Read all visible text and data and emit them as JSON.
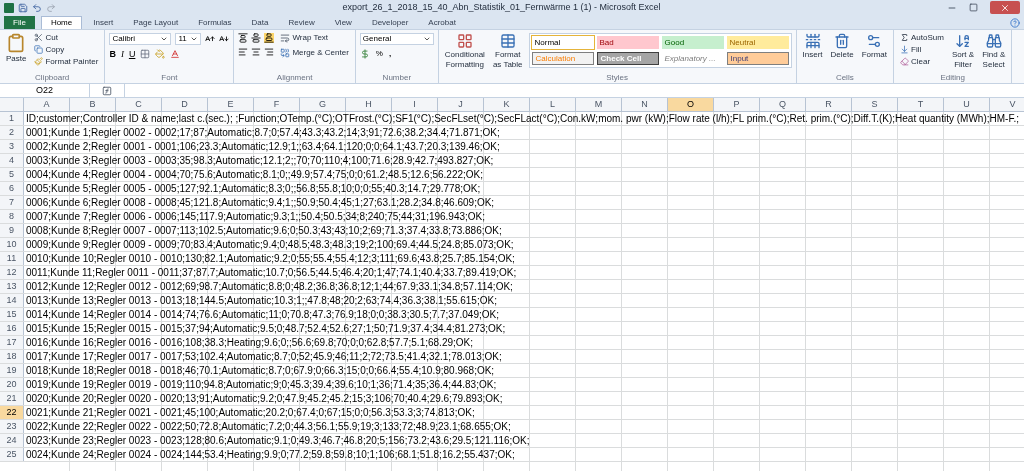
{
  "window": {
    "title": "export_26_1_2018_15_40_Abn_Statistik_01_Fernwärme 1 (1)  -  Microsoft Excel"
  },
  "tabs": [
    {
      "label": "File",
      "kind": "file",
      "selected": false
    },
    {
      "label": "Home",
      "kind": "tab",
      "selected": true
    },
    {
      "label": "Insert",
      "kind": "tab",
      "selected": false
    },
    {
      "label": "Page Layout",
      "kind": "tab",
      "selected": false
    },
    {
      "label": "Formulas",
      "kind": "tab",
      "selected": false
    },
    {
      "label": "Data",
      "kind": "tab",
      "selected": false
    },
    {
      "label": "Review",
      "kind": "tab",
      "selected": false
    },
    {
      "label": "View",
      "kind": "tab",
      "selected": false
    },
    {
      "label": "Developer",
      "kind": "tab",
      "selected": false
    },
    {
      "label": "Acrobat",
      "kind": "tab",
      "selected": false
    }
  ],
  "ribbon": {
    "clipboard": {
      "label": "Clipboard",
      "paste": "Paste",
      "cut": "Cut",
      "copy": "Copy",
      "format_painter": "Format Painter"
    },
    "font": {
      "label": "Font",
      "font_name": "Calibri",
      "font_size": "11",
      "bold": "B",
      "italic": "I",
      "underline": "U"
    },
    "alignment": {
      "label": "Alignment",
      "wrap_text": "Wrap Text",
      "merge_center": "Merge & Center"
    },
    "number": {
      "label": "Number",
      "format": "General",
      "percent": "%",
      "comma": ","
    },
    "styles": {
      "label": "Styles",
      "conditional": [
        "Conditional",
        "Formatting"
      ],
      "format_table": [
        "Format",
        "as Table"
      ],
      "gallery": [
        {
          "label": "Normal",
          "kind": "normal",
          "selected": true
        },
        {
          "label": "Bad",
          "kind": "bad",
          "selected": false
        },
        {
          "label": "Good",
          "kind": "good",
          "selected": false
        },
        {
          "label": "Neutral",
          "kind": "neutral",
          "selected": false
        },
        {
          "label": "Calculation",
          "kind": "calculation",
          "selected": false
        },
        {
          "label": "Check Cell",
          "kind": "check",
          "selected": false
        },
        {
          "label": "Explanatory ...",
          "kind": "explanatory",
          "selected": false
        },
        {
          "label": "Input",
          "kind": "input",
          "selected": false
        }
      ]
    },
    "cells": {
      "label": "Cells",
      "buttons": [
        "Insert",
        "Delete",
        "Format"
      ]
    },
    "editing": {
      "label": "Editing",
      "autosum": "AutoSum",
      "fill": "Fill",
      "clear": "Clear",
      "sort": [
        "Sort &",
        "Filter"
      ],
      "find": [
        "Find &",
        "Select"
      ]
    }
  },
  "formula_bar": {
    "name_box": "O22"
  },
  "columns": [
    {
      "label": "A",
      "selected": false
    },
    {
      "label": "B",
      "selected": false
    },
    {
      "label": "C",
      "selected": false
    },
    {
      "label": "D",
      "selected": false
    },
    {
      "label": "E",
      "selected": false
    },
    {
      "label": "F",
      "selected": false
    },
    {
      "label": "G",
      "selected": false
    },
    {
      "label": "H",
      "selected": false
    },
    {
      "label": "I",
      "selected": false
    },
    {
      "label": "J",
      "selected": false
    },
    {
      "label": "K",
      "selected": false
    },
    {
      "label": "L",
      "selected": false
    },
    {
      "label": "M",
      "selected": false
    },
    {
      "label": "N",
      "selected": false
    },
    {
      "label": "O",
      "selected": true
    },
    {
      "label": "P",
      "selected": false
    },
    {
      "label": "Q",
      "selected": false
    },
    {
      "label": "R",
      "selected": false
    },
    {
      "label": "S",
      "selected": false
    },
    {
      "label": "T",
      "selected": false
    },
    {
      "label": "U",
      "selected": false
    },
    {
      "label": "V",
      "selected": false
    }
  ],
  "rows": [
    {
      "number": "1",
      "selected": false,
      "text": "ID;customer;Controller ID & name;last c.(sec.); ;Function;OTemp.(°C);OTFrost.(°C);SF1(°C);SecFLset(°C);SecFLact(°C);Con.kW;mom. pwr (kW);Flow rate (l/h);FL prim.(°C);Ret. prim.(°C);Diff.T.(K);Heat quantity (MWh);HM-F.;"
    },
    {
      "number": "2",
      "selected": false,
      "text": "0001;Kunde 1;Regler 0002 - 0002;17;87;Automatic;8.7;0;57.4;43.3;43.2;14;3;91;72.6;38.2;34.4;71.871;OK;"
    },
    {
      "number": "3",
      "selected": false,
      "text": "0002;Kunde 2;Regler 0001 - 0001;106;23.3;Automatic;12.9;1;;63.4;64.1;120;0;0;64.1;43.7;20.3;139.46;OK;"
    },
    {
      "number": "4",
      "selected": false,
      "text": "0003;Kunde 3;Regler 0003 - 0003;35;98.3;Automatic;12.1;2;;70;70;110;4;100;71.6;28.9;42.7;493.827;OK;"
    },
    {
      "number": "5",
      "selected": false,
      "text": "0004;Kunde 4;Regler 0004 - 0004;70;75.6;Automatic;8.1;0;;49.9;57.4;75;0;0;61.2;48.5;12.6;56.222;OK;"
    },
    {
      "number": "6",
      "selected": false,
      "text": "0005;Kunde 5;Regler 0005 - 0005;127;92.1;Automatic;8.3;0;;56.8;55.8;10;0;0;55;40.3;14.7;29.778;OK;"
    },
    {
      "number": "7",
      "selected": false,
      "text": "0006;Kunde 6;Regler 0008 - 0008;45;121.8;Automatic;9.4;1;;50.9;50.4;45;1;27;63.1;28.2;34.8;46.609;OK;"
    },
    {
      "number": "8",
      "selected": false,
      "text": "0007;Kunde 7;Regler 0006 - 0006;145;117.9;Automatic;9.3;1;;50.4;50.5;34;8;240;75;44;31;196.943;OK;"
    },
    {
      "number": "9",
      "selected": false,
      "text": "0008;Kunde 8;Regler 0007 - 0007;113;102.5;Automatic;9.6;0;50.3;43;43;10;2;69;71.3;37.4;33.8;73.886;OK;"
    },
    {
      "number": "10",
      "selected": false,
      "text": "0009;Kunde 9;Regler 0009 - 0009;70;83.4;Automatic;9.4;0;48.5;48.3;48.3;19;2;100;69.4;44.5;24.8;85.073;OK;"
    },
    {
      "number": "11",
      "selected": false,
      "text": "0010;Kunde 10;Regler 0010 - 0010;130;82.1;Automatic;9.2;0;55;55.4;55.4;12;3;111;69.6;43.8;25.7;85.154;OK;"
    },
    {
      "number": "12",
      "selected": false,
      "text": "0011;Kunde 11;Regler 0011 - 0011;37;87.7;Automatic;10.7;0;56.5;44.5;46.4;20;1;47;74.1;40.4;33.7;89.419;OK;"
    },
    {
      "number": "13",
      "selected": false,
      "text": "0012;Kunde 12;Regler 0012 - 0012;69;98.7;Automatic;8.8;0;48.2;36.8;36.8;12;1;44;67.9;33.1;34.8;57.114;OK;"
    },
    {
      "number": "14",
      "selected": false,
      "text": "0013;Kunde 13;Regler 0013 - 0013;18;144.5;Automatic;10.3;1;;47.8;48;20;2;63;74.4;36.3;38.1;55.615;OK;"
    },
    {
      "number": "15",
      "selected": false,
      "text": "0014;Kunde 14;Regler 0014 - 0014;74;76.6;Automatic;11;0;70.8;47.3;76.9;18;0;0;38.3;30.5;7.7;37.049;OK;"
    },
    {
      "number": "16",
      "selected": false,
      "text": "0015;Kunde 15;Regler 0015 - 0015;37;94;Automatic;9.5;0;48.7;52.4;52.6;27;1;50;71.9;37.4;34.4;81.273;OK;"
    },
    {
      "number": "17",
      "selected": false,
      "text": "0016;Kunde 16;Regler 0016 - 0016;108;38.3;Heating;9.6;0;;56.6;69.8;70;0;0;62.8;57.7;5.1;68.29;OK;"
    },
    {
      "number": "18",
      "selected": false,
      "text": "0017;Kunde 17;Regler 0017 - 0017;53;102.4;Automatic;8.7;0;52;45.9;46;11;2;72;73.5;41.4;32.1;78.013;OK;"
    },
    {
      "number": "19",
      "selected": false,
      "text": "0018;Kunde 18;Regler 0018 - 0018;46;70.1;Automatic;8.7;0;67.9;0;66.3;15;0;0;66.4;55.4;10.9;80.968;OK;"
    },
    {
      "number": "20",
      "selected": false,
      "text": "0019;Kunde 19;Regler 0019 - 0019;110;94.8;Automatic;9;0;45.3;39.4;39.6;10;1;36;71.4;35;36.4;44.83;OK;"
    },
    {
      "number": "21",
      "selected": false,
      "text": "0020;Kunde 20;Regler 0020 - 0020;13;91;Automatic;9.2;0;47.9;45.2;45.2;15;3;106;70;40.4;29.6;79.893;OK;"
    },
    {
      "number": "22",
      "selected": true,
      "text": "0021;Kunde 21;Regler 0021 - 0021;45;100;Automatic;20.2;0;67.4;0;67;15;0;0;56.3;53.3;3;74.813;OK;"
    },
    {
      "number": "23",
      "selected": false,
      "text": "0022;Kunde 22;Regler 0022 - 0022;50;72.8;Automatic;7.2;0;44.3;56.1;55.9;19;3;133;72;48.9;23.1;68.655;OK;"
    },
    {
      "number": "24",
      "selected": false,
      "text": "0023;Kunde 23;Regler 0023 - 0023;128;80.6;Automatic;9.1;0;49.3;46.7;46.8;20;5;156;73.2;43.6;29.5;121.116;OK;"
    },
    {
      "number": "25",
      "selected": false,
      "text": "0024;Kunde 24;Regler 0024 - 0024;144;53.4;Heating;9.9;0;77.2;59.8;59.8;10;1;106;68.1;51.8;16.2;55.437;OK;"
    }
  ]
}
